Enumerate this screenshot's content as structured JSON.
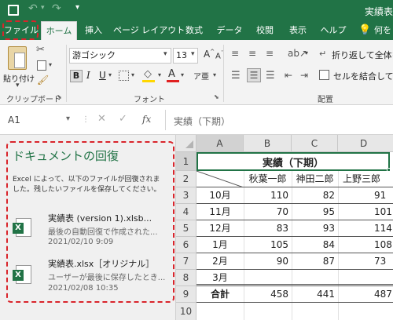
{
  "app": {
    "title": "実績表"
  },
  "tabs": [
    "ファイル",
    "ホーム",
    "挿入",
    "ページ レイアウト",
    "数式",
    "データ",
    "校閲",
    "表示",
    "ヘルプ",
    "何を"
  ],
  "ribbon": {
    "paste_label": "貼り付け",
    "font_name": "游ゴシック",
    "font_size": "13",
    "wrap_text": "折り返して全体を表",
    "merge_center": "セルを結合して中央",
    "groups": [
      "クリップボード",
      "フォント",
      "配置"
    ]
  },
  "formula_bar": {
    "name_box": "A1",
    "fx": "fx",
    "content": "実績（下期）"
  },
  "recovery": {
    "title": "ドキュメントの回復",
    "message": "Excel によって、以下のファイルが回復されました。残したいファイルを保存してください。",
    "files": [
      {
        "name": "実績表 (version 1).xlsb...",
        "desc": "最後の自動回復で作成された...",
        "date": "2021/02/10 9:09"
      },
      {
        "name": "実績表.xlsx［オリジナル］",
        "desc": "ユーザーが最後に保存したとき...",
        "date": "2021/02/08 10:35"
      }
    ]
  },
  "sheet": {
    "col_headers": [
      "A",
      "B",
      "C",
      "D"
    ],
    "row_headers": [
      "1",
      "2",
      "3",
      "4",
      "5",
      "6",
      "7",
      "8",
      "9",
      "10"
    ],
    "title": "実績（下期）",
    "names": [
      "秋葉一郎",
      "神田二郎",
      "上野三郎"
    ],
    "rows": [
      {
        "label": "10月",
        "v": [
          "110",
          "82",
          "91"
        ]
      },
      {
        "label": "11月",
        "v": [
          "70",
          "95",
          "101"
        ]
      },
      {
        "label": "12月",
        "v": [
          "83",
          "93",
          "114"
        ]
      },
      {
        "label": "1月",
        "v": [
          "105",
          "84",
          "108"
        ]
      },
      {
        "label": "2月",
        "v": [
          "90",
          "87",
          "73"
        ]
      },
      {
        "label": "3月",
        "v": [
          "",
          "",
          ""
        ]
      }
    ],
    "total_label": "合計",
    "totals": [
      "458",
      "441",
      "487"
    ]
  },
  "colors": {
    "excel_green": "#217346",
    "highlight_red": "#d9242b"
  }
}
